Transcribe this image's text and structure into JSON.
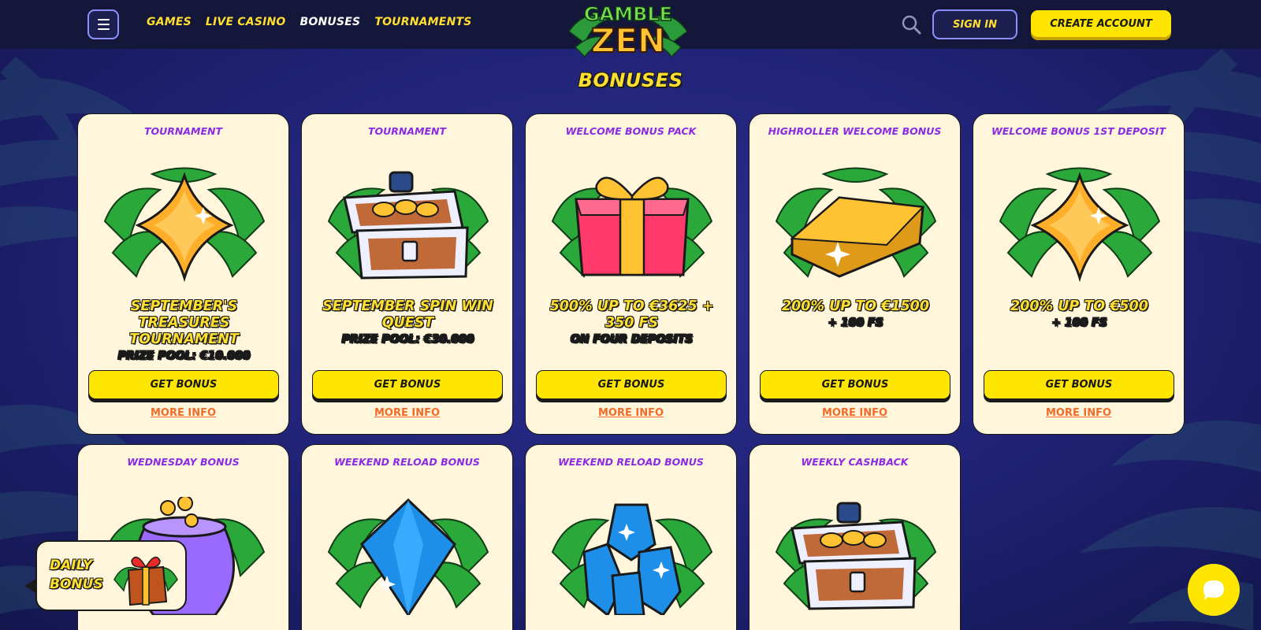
{
  "header": {
    "nav": [
      "GAMES",
      "LIVE CASINO",
      "BONUSES",
      "TOURNAMENTS"
    ],
    "active_nav": "BONUSES",
    "logo_top": "GAMBLE",
    "logo_bottom": "ZEN",
    "sign_in": "SIGN IN",
    "create_account": "CREATE ACCOUNT"
  },
  "page_title": "BONUSES",
  "cards": [
    {
      "category": "TOURNAMENT",
      "title": "SEPTEMBER'S TREASURES TOURNAMENT",
      "subtitle": "Prize Pool: €10.000",
      "art": "star-gem",
      "button": "GET BONUS",
      "more": "MORE INFO"
    },
    {
      "category": "TOURNAMENT",
      "title": "SEPTEMBER SPIN WIN QUEST",
      "subtitle": "Prize Pool: €30.000",
      "art": "treasure-chest",
      "button": "GET BONUS",
      "more": "MORE INFO"
    },
    {
      "category": "WELCOME BONUS PACK",
      "title": "500% UP TO €3625 + 350 FS",
      "subtitle": "On Four Deposits",
      "art": "gift-box",
      "button": "GET BONUS",
      "more": "MORE INFO"
    },
    {
      "category": "HIGHROLLER WELCOME BONUS",
      "title": "200% UP TO €1500",
      "subtitle": "+ 100 FS",
      "art": "gold-bar",
      "button": "GET BONUS",
      "more": "MORE INFO"
    },
    {
      "category": "WELCOME BONUS 1ST DEPOSIT",
      "title": "200% UP TO €500",
      "subtitle": "+ 100 FS",
      "art": "star-gem",
      "button": "GET BONUS",
      "more": "MORE INFO"
    },
    {
      "category": "WEDNESDAY BONUS",
      "art": "coin-pot"
    },
    {
      "category": "WEEKEND RELOAD BONUS",
      "art": "blue-gem"
    },
    {
      "category": "WEEKEND RELOAD BONUS",
      "art": "blue-crystals"
    },
    {
      "category": "WEEKLY CASHBACK",
      "art": "treasure-chest"
    }
  ],
  "daily_bonus": "DAILY BONUS",
  "colors": {
    "accent_yellow": "#ffe600",
    "category_purple": "#8b2be2",
    "more_info_orange": "#f06a2a",
    "card_bg": "#fff6dc",
    "header_bg": "#14173a"
  }
}
